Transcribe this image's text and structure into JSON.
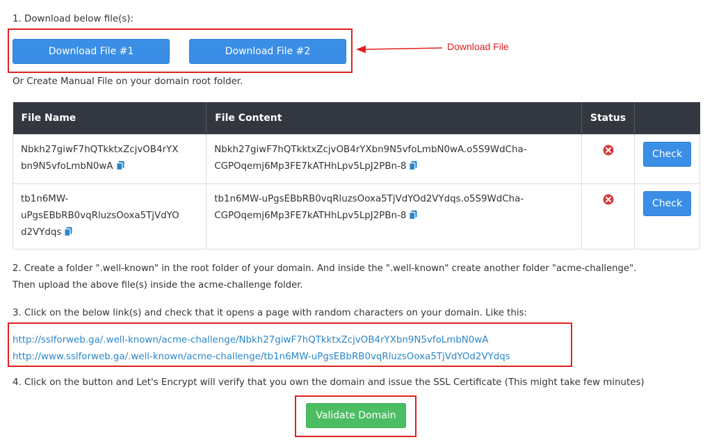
{
  "step1": {
    "heading": "1. Download below file(s):",
    "download1_label": "Download File #1",
    "download2_label": "Download File #2",
    "annotation": "Download File",
    "manual_text": "Or Create Manual File on your domain root folder."
  },
  "table": {
    "headers": [
      "File Name",
      "File Content",
      "Status",
      ""
    ],
    "rows": [
      {
        "name_line1": "Nbkh27giwF7hQTkktxZcjvOB4rYX",
        "name_line2": "bn9N5vfoLmbN0wA",
        "name_line3": "",
        "content_line1": "Nbkh27giwF7hQTkktxZcjvOB4rYXbn9N5vfoLmbN0wA.o5S9WdCha-",
        "content_line2": "CGPOqemj6Mp3FE7kATHhLpv5LpJ2PBn-8",
        "check_label": "Check"
      },
      {
        "name_line1": "tb1n6MW-",
        "name_line2": "uPgsEBbRB0vqRluzsOoxa5TjVdYO",
        "name_line3": "d2VYdqs",
        "content_line1": "tb1n6MW-uPgsEBbRB0vqRluzsOoxa5TjVdYOd2VYdqs.o5S9WdCha-",
        "content_line2": "CGPOqemj6Mp3FE7kATHhLpv5LpJ2PBn-8",
        "check_label": "Check"
      }
    ]
  },
  "step2": {
    "line1": "2. Create a folder \".well-known\" in the root folder of your domain. And inside the \".well-known\" create another folder \"acme-challenge\".",
    "line2": "Then upload the above file(s) inside the acme-challenge folder."
  },
  "step3": {
    "heading": "3. Click on the below link(s) and check that it opens a page with random characters on your domain. Like this:",
    "links": [
      "http://sslforweb.ga/.well-known/acme-challenge/Nbkh27giwF7hQTkktxZcjvOB4rYXbn9N5vfoLmbN0wA",
      "http://www.sslforweb.ga/.well-known/acme-challenge/tb1n6MW-uPgsEBbRB0vqRluzsOoxa5TjVdYOd2VYdqs"
    ]
  },
  "step4": {
    "heading": "4. Click on the button and Let's Encrypt will verify that you own the domain and issue the SSL Certificate (This might take few minutes)",
    "validate_label": "Validate Domain"
  },
  "colors": {
    "primary": "#3a8ee6",
    "success": "#4cbd63",
    "danger": "#e02020",
    "link": "#2a86c9",
    "table_header": "#333840"
  }
}
